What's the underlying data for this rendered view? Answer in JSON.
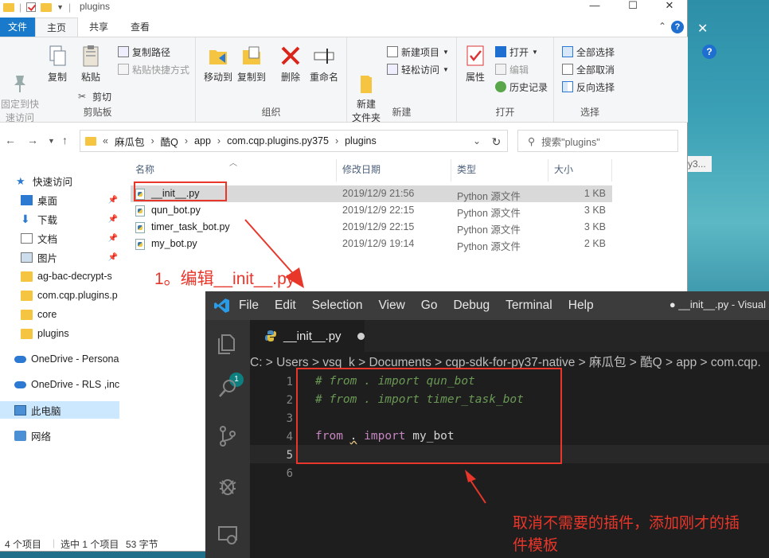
{
  "explorer": {
    "window_title": "plugins",
    "tabs": [
      "文件",
      "主页",
      "共享",
      "查看"
    ],
    "ribbon": {
      "clipboard": {
        "label": "剪贴板",
        "pin_quick": "固定到快\n速访问",
        "copy": "复制",
        "paste": "粘贴",
        "copy_path": "复制路径",
        "paste_shortcut": "粘贴快捷方式",
        "cut": "剪切"
      },
      "organize": {
        "label": "组织",
        "move_to": "移动到",
        "copy_to": "复制到",
        "delete": "删除",
        "rename": "重命名"
      },
      "new": {
        "label": "新建",
        "new_folder": "新建\n文件夹",
        "new_item": "新建项目",
        "easy_access": "轻松访问"
      },
      "open": {
        "label": "打开",
        "properties": "属性",
        "open": "打开",
        "edit": "编辑",
        "history": "历史记录"
      },
      "select": {
        "label": "选择",
        "select_all": "全部选择",
        "select_none": "全部取消",
        "invert": "反向选择"
      }
    },
    "address": {
      "prefix": "«",
      "crumbs": [
        "麻瓜包",
        "酷Q",
        "app",
        "com.cqp.plugins.py375",
        "plugins"
      ],
      "search_placeholder": "搜索\"plugins\""
    },
    "nav": [
      {
        "label": "快速访问",
        "icon": "star-icon"
      },
      {
        "label": "桌面",
        "icon": "desktop-icon",
        "pinned": true
      },
      {
        "label": "下载",
        "icon": "download-icon",
        "pinned": true
      },
      {
        "label": "文档",
        "icon": "document-icon",
        "pinned": true
      },
      {
        "label": "图片",
        "icon": "picture-icon",
        "pinned": true
      },
      {
        "label": "ag-bac-decrypt-s",
        "icon": "folder-icon"
      },
      {
        "label": "com.cqp.plugins.p",
        "icon": "folder-icon"
      },
      {
        "label": "core",
        "icon": "folder-icon"
      },
      {
        "label": "plugins",
        "icon": "folder-icon"
      },
      {
        "label": "OneDrive - Persona",
        "icon": "cloud-icon"
      },
      {
        "label": "OneDrive - RLS ,inc",
        "icon": "cloud-icon"
      },
      {
        "label": "此电脑",
        "icon": "computer-icon",
        "selected": true
      },
      {
        "label": "网络",
        "icon": "network-icon"
      }
    ],
    "columns": [
      "名称",
      "修改日期",
      "类型",
      "大小"
    ],
    "files": [
      {
        "name": "__init__.py",
        "date": "2019/12/9 21:56",
        "type": "Python 源文件",
        "size": "1 KB",
        "selected": true
      },
      {
        "name": "qun_bot.py",
        "date": "2019/12/9 22:15",
        "type": "Python 源文件",
        "size": "3 KB"
      },
      {
        "name": "timer_task_bot.py",
        "date": "2019/12/9 22:15",
        "type": "Python 源文件",
        "size": "3 KB"
      },
      {
        "name": "my_bot.py",
        "date": "2019/12/9 19:14",
        "type": "Python 源文件",
        "size": "2 KB"
      }
    ],
    "status": {
      "count": "4 个项目",
      "selected": "选中 1 个项目",
      "size": "53 字节"
    }
  },
  "background": {
    "fragment": "y3..."
  },
  "annotations": {
    "step1": "1。编辑__init__.py",
    "note": "取消不需要的插件，添加刚才的插\n件模板",
    "color": "#e8362a"
  },
  "vscode": {
    "menu": [
      "File",
      "Edit",
      "Selection",
      "View",
      "Go",
      "Debug",
      "Terminal",
      "Help"
    ],
    "window_title": "● __init__.py - Visual",
    "tab": "__init__.py",
    "breadcrumb": "C: > Users > vsq_k > Documents > cqp-sdk-for-py37-native > 麻瓜包 > 酷Q > app > com.cqp.",
    "badge": "1",
    "lines": [
      {
        "n": "1",
        "text": "# from . import qun_bot"
      },
      {
        "n": "2",
        "text": "# from . import timer_task_bot"
      },
      {
        "n": "3",
        "text": ""
      },
      {
        "n": "4",
        "kw1": "from",
        "dot": ".",
        "kw2": "import",
        "name": "my_bot"
      },
      {
        "n": "5",
        "text": ""
      },
      {
        "n": "6",
        "text": ""
      }
    ]
  }
}
